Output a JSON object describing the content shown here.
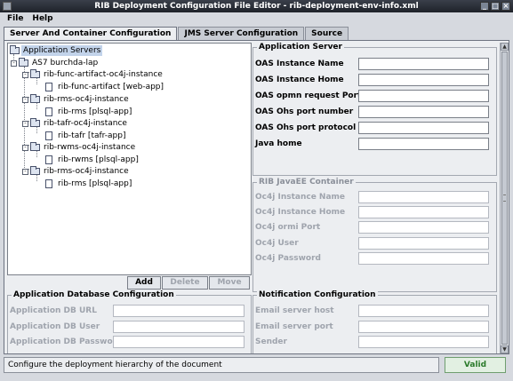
{
  "window": {
    "title": "RIB Deployment Configuration File Editor - rib-deployment-env-info.xml"
  },
  "menu": {
    "file": "File",
    "help": "Help"
  },
  "tabs": [
    {
      "label": "Server And Container Configuration",
      "active": true
    },
    {
      "label": "JMS Server Configuration",
      "active": false
    },
    {
      "label": "Source",
      "active": false
    }
  ],
  "tree": {
    "root": "Application Servers",
    "host": "AS7 burchda-lap",
    "instances": [
      {
        "name": "rib-func-artifact-oc4j-instance",
        "app": "rib-func-artifact  [web-app]"
      },
      {
        "name": "rib-rms-oc4j-instance",
        "app": "rib-rms  [plsql-app]"
      },
      {
        "name": "rib-tafr-oc4j-instance",
        "app": "rib-tafr  [tafr-app]"
      },
      {
        "name": "rib-rwms-oc4j-instance",
        "app": "rib-rwms  [plsql-app]"
      },
      {
        "name": "rib-rms-oc4j-instance",
        "app": "rib-rms  [plsql-app]"
      }
    ]
  },
  "buttons": {
    "add": "Add",
    "delete": "Delete",
    "move": "Move"
  },
  "app_server": {
    "title": "Application Server",
    "fields": [
      "OAS Instance Name",
      "OAS Instance Home",
      "OAS opmn request Port",
      "OAS Ohs port number",
      "OAS Ohs port protocol",
      "Java home"
    ]
  },
  "javaee": {
    "title": "RIB JavaEE Container",
    "fields": [
      "Oc4j Instance Name",
      "Oc4j Instance Home",
      "Oc4j ormi Port",
      "Oc4j User",
      "Oc4j Password"
    ]
  },
  "app_db": {
    "title": "Application Database Configuration",
    "fields": [
      "Application DB URL",
      "Application DB User",
      "Application DB Passwo..."
    ]
  },
  "notification": {
    "title": "Notification Configuration",
    "fields": [
      "Email server host",
      "Email server port",
      "Sender"
    ]
  },
  "status": {
    "message": "Configure the deployment hierarchy of the document",
    "valid": "Valid"
  }
}
